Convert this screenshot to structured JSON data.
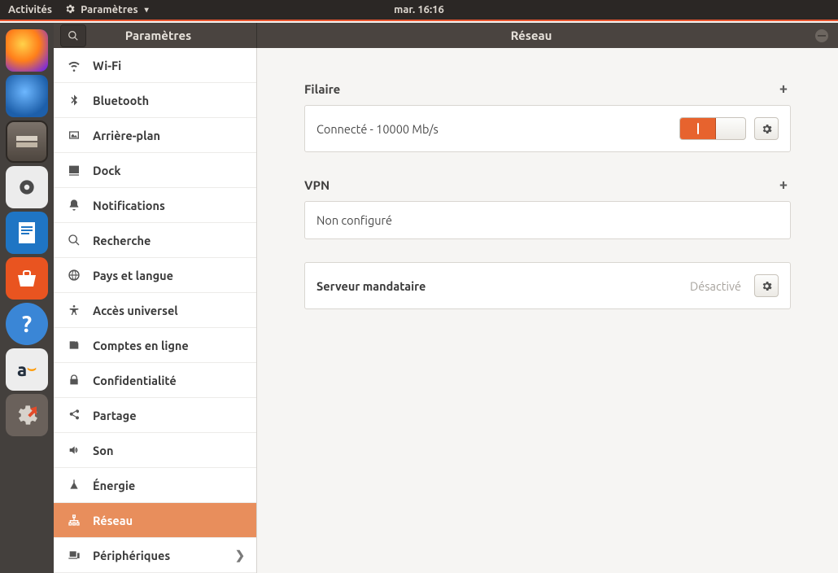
{
  "panel": {
    "activities": "Activités",
    "app_menu": "Paramètres",
    "clock": "mar. 16:16"
  },
  "dock": {
    "items": [
      {
        "name": "firefox",
        "glyph": "🦊"
      },
      {
        "name": "thunderbird",
        "glyph": "🕊️"
      },
      {
        "name": "files",
        "glyph": "🗄️"
      },
      {
        "name": "rhythmbox",
        "glyph": "🔈"
      },
      {
        "name": "libreoffice-writer",
        "glyph": "📄"
      },
      {
        "name": "software",
        "glyph": "🛍️"
      },
      {
        "name": "help",
        "glyph": "❓"
      },
      {
        "name": "amazon",
        "glyph": "🅰️"
      },
      {
        "name": "settings",
        "glyph": "🛠️"
      }
    ]
  },
  "titlebar": {
    "left": "Paramètres",
    "center": "Réseau"
  },
  "sidebar": {
    "items": [
      {
        "label": "Wi-Fi",
        "icon": "wifi"
      },
      {
        "label": "Bluetooth",
        "icon": "bluetooth"
      },
      {
        "label": "Arrière-plan",
        "icon": "background"
      },
      {
        "label": "Dock",
        "icon": "dock"
      },
      {
        "label": "Notifications",
        "icon": "bell"
      },
      {
        "label": "Recherche",
        "icon": "search"
      },
      {
        "label": "Pays et langue",
        "icon": "globe"
      },
      {
        "label": "Accès universel",
        "icon": "accessibility"
      },
      {
        "label": "Comptes en ligne",
        "icon": "accounts"
      },
      {
        "label": "Confidentialité",
        "icon": "privacy"
      },
      {
        "label": "Partage",
        "icon": "share"
      },
      {
        "label": "Son",
        "icon": "sound"
      },
      {
        "label": "Énergie",
        "icon": "power"
      },
      {
        "label": "Réseau",
        "icon": "network",
        "selected": true
      },
      {
        "label": "Périphériques",
        "icon": "devices",
        "chevron": true
      }
    ]
  },
  "main": {
    "wired": {
      "title": "Filaire",
      "status": "Connecté - 10000 Mb/s"
    },
    "vpn": {
      "title": "VPN",
      "status": "Non configuré"
    },
    "proxy": {
      "label": "Serveur mandataire",
      "status": "Désactivé"
    }
  }
}
